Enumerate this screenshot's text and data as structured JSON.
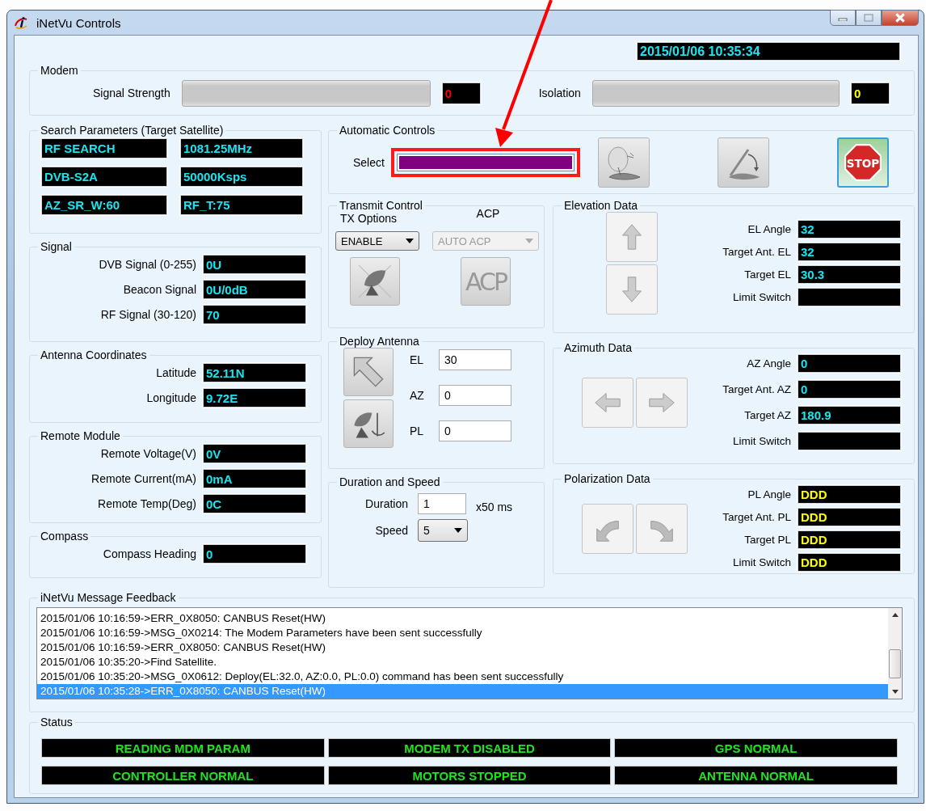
{
  "window": {
    "title": "iNetVu Controls"
  },
  "clock": "2015/01/06 10:35:34",
  "modem": {
    "title": "Modem",
    "meters": [
      {
        "label": "Signal Strength",
        "reading": "0",
        "kind": "alert"
      },
      {
        "label": "Isolation",
        "reading": "0",
        "kind": "warning"
      }
    ]
  },
  "search_parameters": {
    "title": "Search Parameters (Target Satellite)",
    "values": [
      "RF SEARCH",
      "1081.25MHz",
      "DVB-S2A",
      "50000Ksps",
      "AZ_SR_W:60",
      "RF_T:75"
    ]
  },
  "signal": {
    "title": "Signal",
    "rows": [
      {
        "label": "DVB Signal (0-255)",
        "value": "0U"
      },
      {
        "label": "Beacon Signal",
        "value": "0U/0dB"
      },
      {
        "label": "RF Signal (30-120)",
        "value": "70"
      }
    ]
  },
  "antenna_coordinates": {
    "title": "Antenna Coordinates",
    "rows": [
      {
        "label": "Latitude",
        "value": "52.11N"
      },
      {
        "label": "Longitude",
        "value": "9.72E"
      }
    ]
  },
  "remote_module": {
    "title": "Remote Module",
    "rows": [
      {
        "label": "Remote Voltage(V)",
        "value": "0V"
      },
      {
        "label": "Remote Current(mA)",
        "value": "0mA"
      },
      {
        "label": "Remote Temp(Deg)",
        "value": "0C"
      }
    ]
  },
  "compass": {
    "title": "Compass",
    "rows": [
      {
        "label": "Compass Heading",
        "value": "0"
      }
    ]
  },
  "automatic_controls": {
    "title": "Automatic Controls",
    "select": {
      "label": "Select",
      "level": 1,
      "highlighted": true
    },
    "buttons": [
      {
        "kind": "dish"
      },
      {
        "kind": "stow"
      },
      {
        "kind": "stop",
        "label": "STOP"
      }
    ]
  },
  "transmit_control": {
    "title": "Transmit Control",
    "dropdowns": [
      {
        "label": "TX Options",
        "value": "ENABLE",
        "disabled": false
      },
      {
        "label": "ACP",
        "value": "AUTO ACP",
        "disabled": true
      }
    ],
    "buttons": [
      {
        "kind": "dish-crossed"
      },
      {
        "kind": "text",
        "label": "ACP"
      }
    ]
  },
  "deploy_antenna": {
    "title": "Deploy Antenna",
    "buttons": [
      {
        "kind": "arrow-up-left"
      },
      {
        "kind": "dish-axes"
      }
    ],
    "fields": [
      {
        "label": "EL",
        "value": "30"
      },
      {
        "label": "AZ",
        "value": "0"
      },
      {
        "label": "PL",
        "value": "0"
      }
    ]
  },
  "duration_and_speed": {
    "title": "Duration and Speed",
    "duration": {
      "label": "Duration",
      "value": "1",
      "unit": "x50 ms"
    },
    "speed": {
      "label": "Speed",
      "value": "5"
    }
  },
  "elevation_data": {
    "title": "Elevation Data",
    "buttons": [
      {
        "kind": "up"
      },
      {
        "kind": "down"
      }
    ],
    "rows": [
      {
        "label": "EL Angle",
        "value": "32"
      },
      {
        "label": "Target Ant. EL",
        "value": "32"
      },
      {
        "label": "Target EL",
        "value": "30.3"
      },
      {
        "label": "Limit Switch"
      }
    ]
  },
  "azimuth_data": {
    "title": "Azimuth Data",
    "buttons": [
      {
        "kind": "left"
      },
      {
        "kind": "right"
      }
    ],
    "rows": [
      {
        "label": "AZ Angle",
        "value": "0"
      },
      {
        "label": "Target Ant. AZ",
        "value": "0"
      },
      {
        "label": "Target AZ",
        "value": "180.9"
      },
      {
        "label": "Limit Switch"
      }
    ]
  },
  "polarization_data": {
    "title": "Polarization Data",
    "buttons": [
      {
        "kind": "ccw"
      },
      {
        "kind": "cw"
      }
    ],
    "rows": [
      {
        "label": "PL Angle",
        "value": "DDD",
        "kind": "warning"
      },
      {
        "label": "Target Ant. PL",
        "value": "DDD",
        "kind": "warning"
      },
      {
        "label": "Target PL",
        "value": "DDD",
        "kind": "warning"
      },
      {
        "label": "Limit Switch",
        "value": "DDD",
        "kind": "warning"
      }
    ]
  },
  "message_feedback": {
    "title": "iNetVu Message Feedback",
    "messages": [
      {
        "text": "2015/01/06 10:16:59->ERR_0X8050: CANBUS Reset(HW)",
        "selected": false
      },
      {
        "text": "2015/01/06 10:16:59->MSG_0X0214: The Modem Parameters have been sent successfully",
        "selected": false
      },
      {
        "text": "2015/01/06 10:16:59->ERR_0X8050: CANBUS Reset(HW)",
        "selected": false
      },
      {
        "text": "2015/01/06 10:35:20->Find Satellite.",
        "selected": false
      },
      {
        "text": "2015/01/06 10:35:20->MSG_0X0612: Deploy(EL:32.0, AZ:0.0, PL:0.0) command has been sent successfully",
        "selected": false
      },
      {
        "text": "2015/01/06 10:35:28->ERR_0X8050: CANBUS Reset(HW)",
        "selected": true
      }
    ]
  },
  "status": {
    "title": "Status",
    "items": [
      "READING MDM PARAM",
      "MODEM TX DISABLED",
      "GPS NORMAL",
      "CONTROLLER NORMAL",
      "MOTORS STOPPED",
      "ANTENNA NORMAL"
    ]
  }
}
